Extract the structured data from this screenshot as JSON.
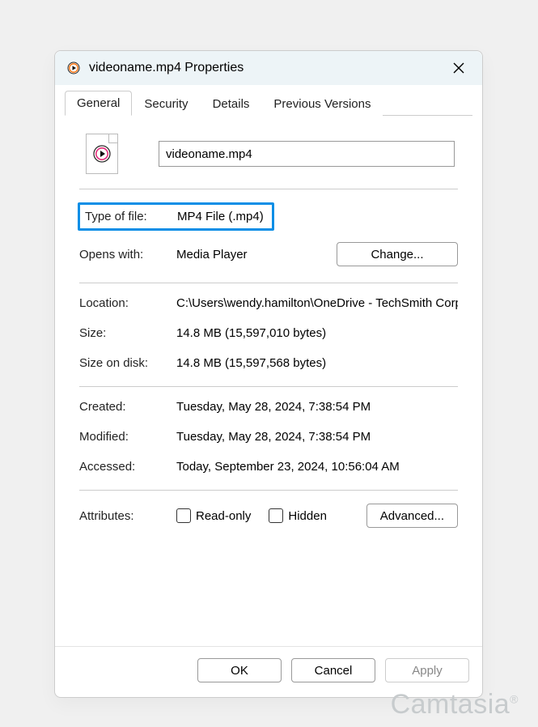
{
  "window": {
    "title": "videoname.mp4 Properties",
    "close_label": "Close"
  },
  "tabs": {
    "general": "General",
    "security": "Security",
    "details": "Details",
    "previous_versions": "Previous Versions"
  },
  "file": {
    "name": "videoname.mp4"
  },
  "props": {
    "type_label": "Type of file:",
    "type_value": "MP4 File (.mp4)",
    "opens_label": "Opens with:",
    "opens_value": "Media Player",
    "change_label": "Change...",
    "location_label": "Location:",
    "location_value": "C:\\Users\\wendy.hamilton\\OneDrive - TechSmith Corp",
    "size_label": "Size:",
    "size_value": "14.8 MB (15,597,010 bytes)",
    "size_on_disk_label": "Size on disk:",
    "size_on_disk_value": "14.8 MB (15,597,568 bytes)",
    "created_label": "Created:",
    "created_value": "Tuesday, May 28, 2024, 7:38:54 PM",
    "modified_label": "Modified:",
    "modified_value": "Tuesday, May 28, 2024, 7:38:54 PM",
    "accessed_label": "Accessed:",
    "accessed_value": "Today, September 23, 2024, 10:56:04 AM",
    "attributes_label": "Attributes:",
    "readonly_label": "Read-only",
    "hidden_label": "Hidden",
    "advanced_label": "Advanced..."
  },
  "footer": {
    "ok": "OK",
    "cancel": "Cancel",
    "apply": "Apply"
  },
  "watermark": "Camtasia"
}
